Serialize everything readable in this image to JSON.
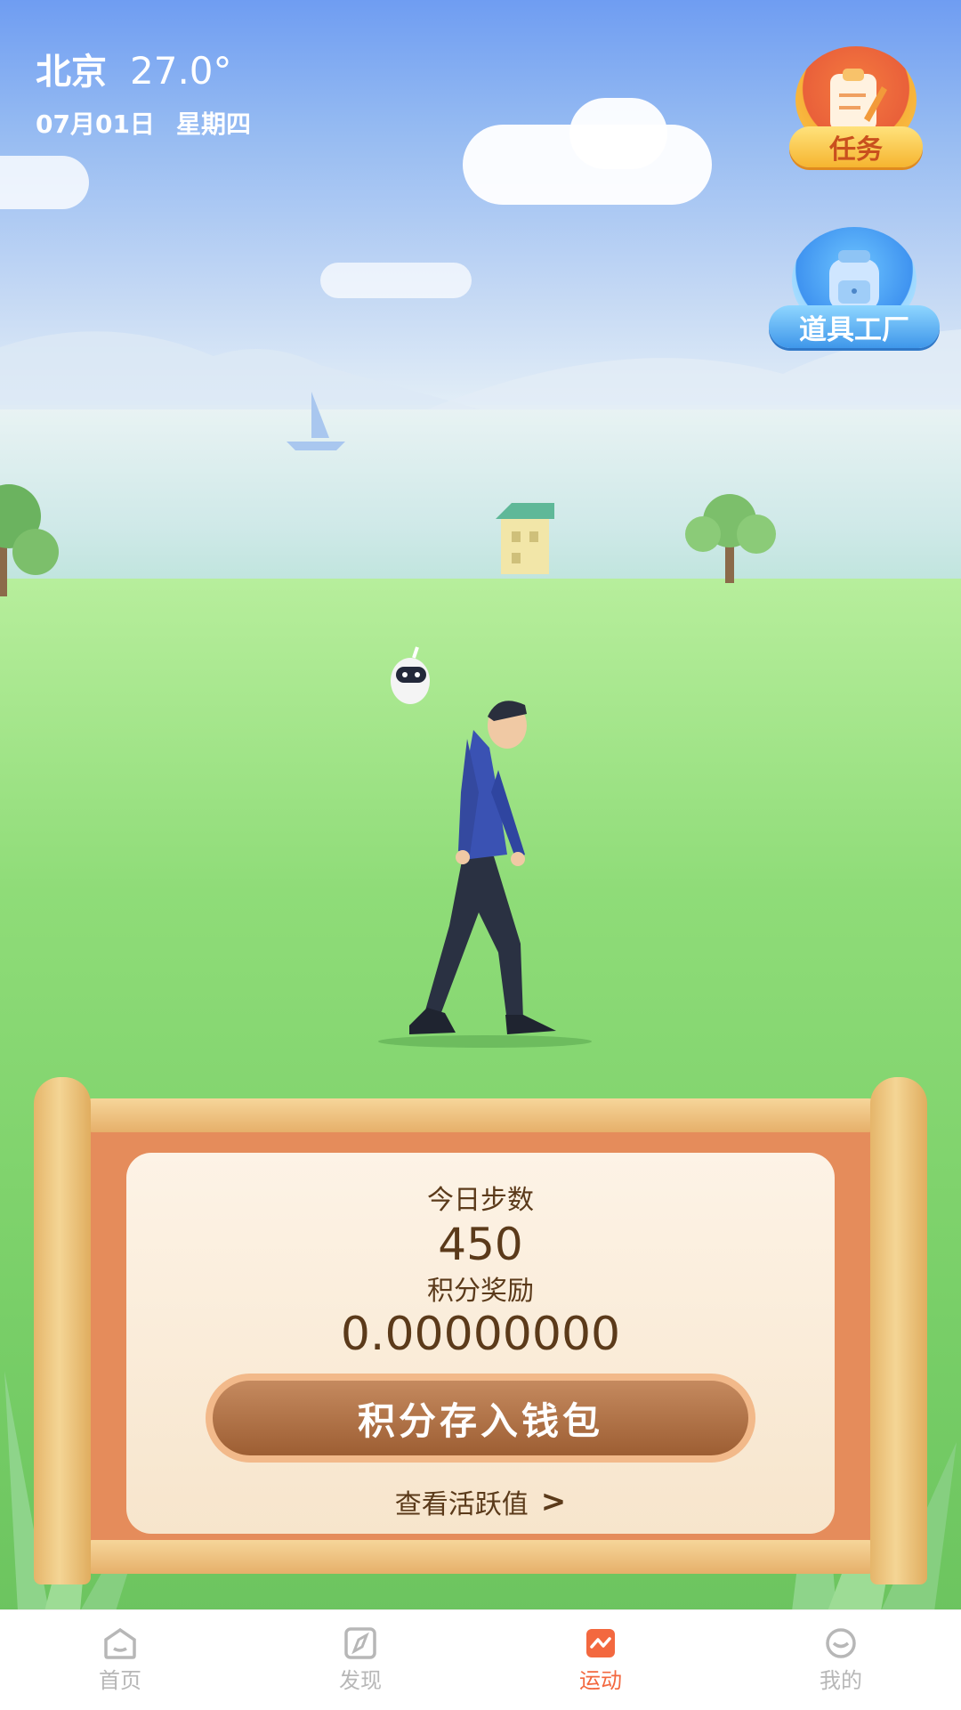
{
  "weather": {
    "city": "北京",
    "temperature": "27.0°",
    "date": "07月01日",
    "weekday": "星期四"
  },
  "side_buttons": {
    "task": "任务",
    "tool_factory": "道具工厂"
  },
  "card": {
    "steps_label": "今日步数",
    "steps_value": "450",
    "reward_label": "积分奖励",
    "reward_value": "0.00000000",
    "deposit_button": "积分存入钱包",
    "activity_link": "查看活跃值",
    "activity_chevron": ">"
  },
  "tabbar": [
    {
      "label": "首页",
      "icon": "home-icon"
    },
    {
      "label": "发现",
      "icon": "compass-icon"
    },
    {
      "label": "运动",
      "icon": "activity-icon",
      "active": true
    },
    {
      "label": "我的",
      "icon": "smile-icon"
    }
  ],
  "colors": {
    "accent": "#f3683f",
    "brown_text": "#5b3a1a",
    "inactive_tab": "#b7b7b7"
  }
}
